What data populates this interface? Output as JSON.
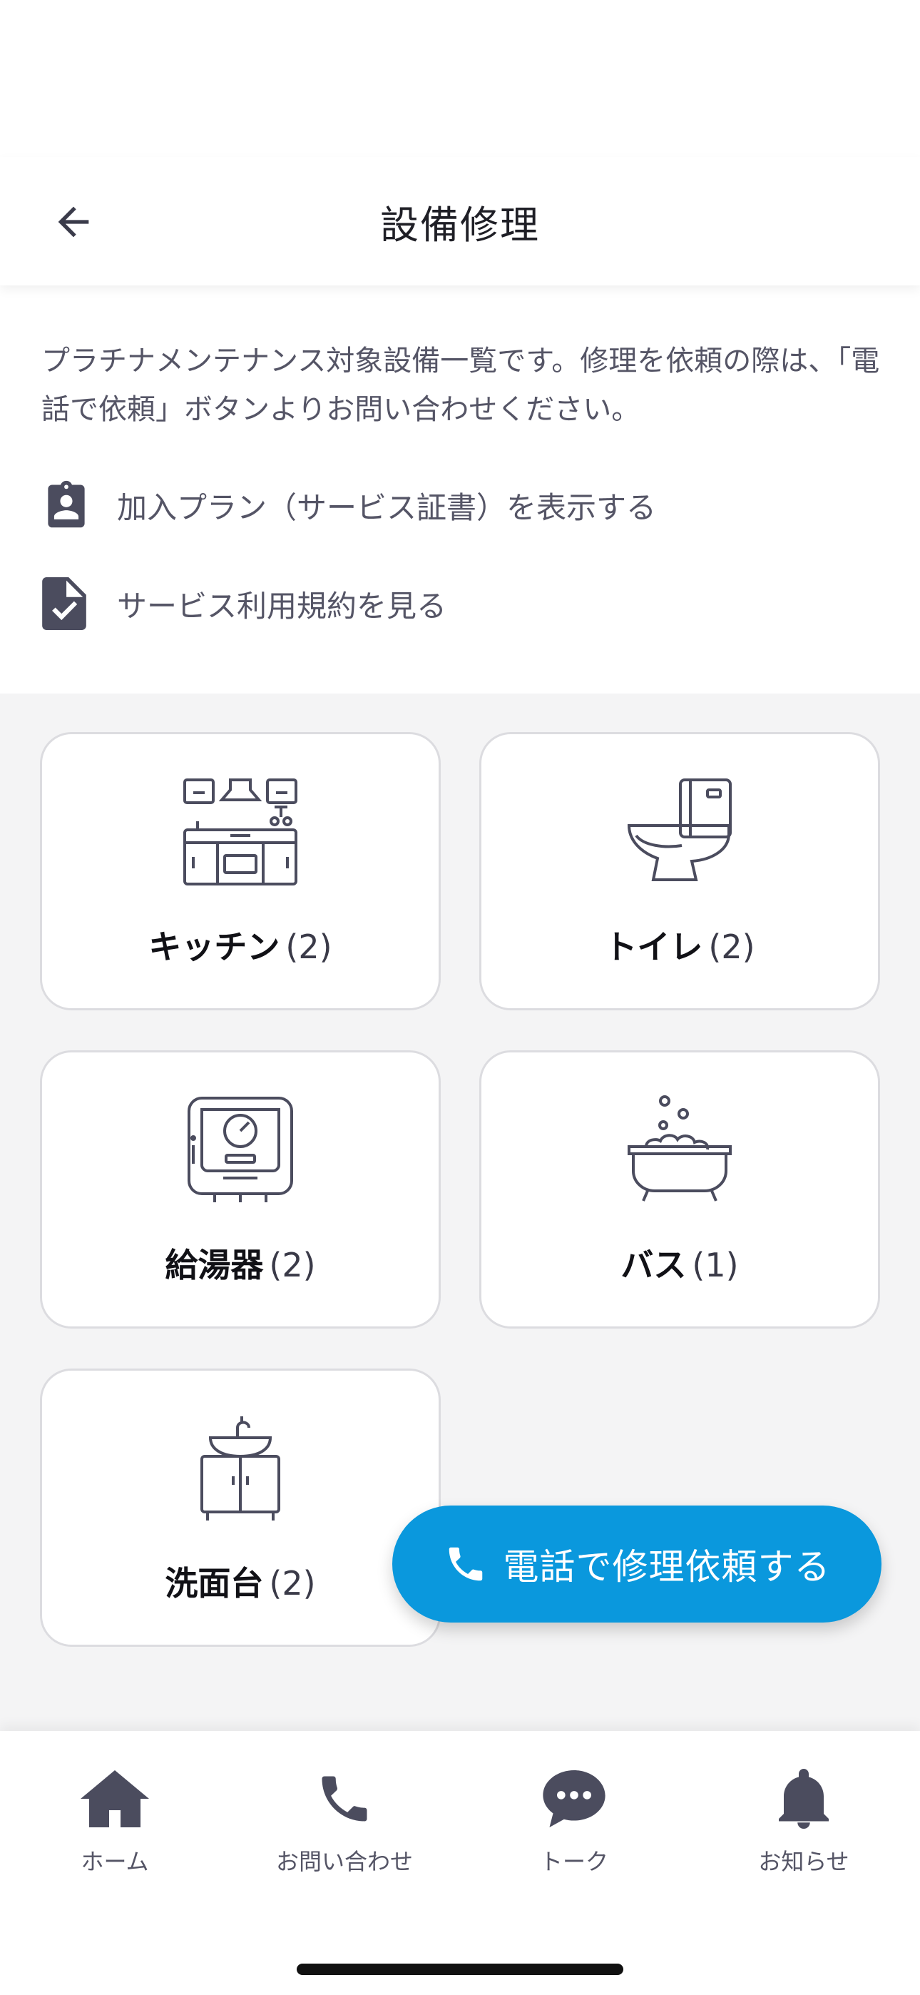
{
  "header": {
    "title": "設備修理"
  },
  "info": {
    "description": "プラチナメンテナンス対象設備一覧です。修理を依頼の際は、「電話で依頼」ボタンよりお問い合わせください。",
    "plan_link": "加入プラン（サービス証書）を表示する",
    "terms_link": "サービス利用規約を見る"
  },
  "categories": [
    {
      "name": "キッチン",
      "count": "(2)",
      "icon": "kitchen-icon"
    },
    {
      "name": "トイレ",
      "count": "(2)",
      "icon": "toilet-icon"
    },
    {
      "name": "給湯器",
      "count": "(2)",
      "icon": "water-heater-icon"
    },
    {
      "name": "バス",
      "count": "(1)",
      "icon": "bathtub-icon"
    },
    {
      "name": "洗面台",
      "count": "(2)",
      "icon": "washbasin-icon"
    }
  ],
  "fab": {
    "label": "電話で修理依頼する",
    "icon": "phone-icon"
  },
  "nav": [
    {
      "label": "ホーム",
      "icon": "home-icon"
    },
    {
      "label": "お問い合わせ",
      "icon": "phone-icon"
    },
    {
      "label": "トーク",
      "icon": "chat-icon"
    },
    {
      "label": "お知らせ",
      "icon": "bell-icon"
    }
  ],
  "colors": {
    "accent": "#0a98dd",
    "icon": "#4b4c5e",
    "text": "#555566"
  }
}
